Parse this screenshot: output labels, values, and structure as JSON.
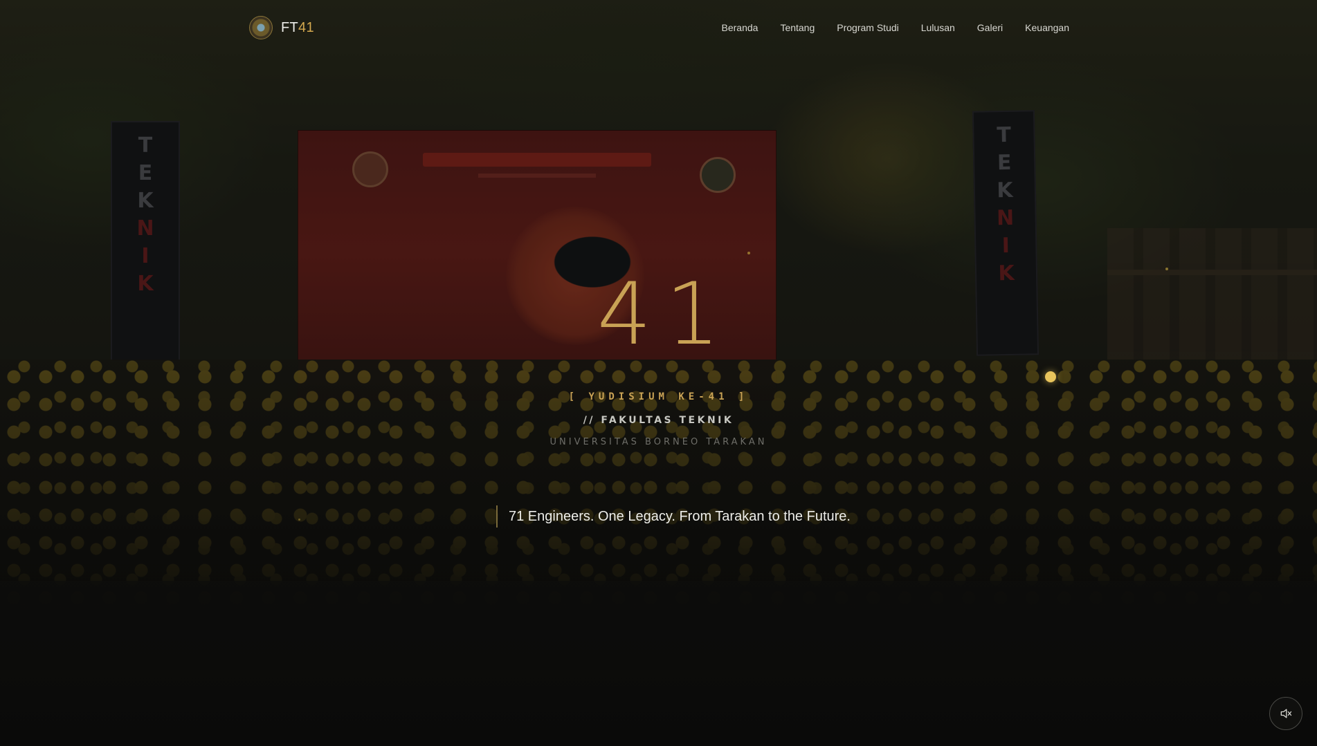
{
  "brand": {
    "name_prefix": "FT",
    "name_number": "41",
    "logo_icon": "faculty-emblem-icon"
  },
  "nav": {
    "items": [
      {
        "label": "Beranda"
      },
      {
        "label": "Tentang"
      },
      {
        "label": "Program Studi"
      },
      {
        "label": "Lulusan"
      },
      {
        "label": "Galeri"
      },
      {
        "label": "Keuangan"
      }
    ]
  },
  "hero": {
    "number": "41",
    "kicker": "[ YUDISIUM KE-41 ]",
    "faculty": "// FAKULTAS TEKNIK",
    "university": "UNIVERSITAS BORNEO TARAKAN",
    "tagline": "71 Engineers. One Legacy. From Tarakan to the Future."
  },
  "audio": {
    "icon": "speaker-muted-icon",
    "muted": true
  },
  "colors": {
    "accent_gold": "#c9a255",
    "text_light": "#eeeeea",
    "background": "#0b0b0a"
  }
}
